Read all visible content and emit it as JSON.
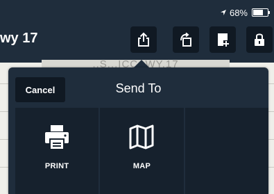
{
  "status_bar": {
    "battery": "68%",
    "battery_level": 0.68
  },
  "header": {
    "title": "wy 17"
  },
  "document": {
    "visible_text": "..S...ICC..WY.17"
  },
  "toolbar": {
    "buttons": [
      {
        "icon": "share-icon"
      },
      {
        "icon": "rotate-icon"
      },
      {
        "icon": "add-page-icon"
      },
      {
        "icon": "lock-icon"
      }
    ]
  },
  "popover": {
    "title": "Send To",
    "cancel_label": "Cancel",
    "options": [
      {
        "label": "PRINT",
        "icon": "printer-icon"
      },
      {
        "label": "MAP",
        "icon": "map-icon"
      }
    ]
  },
  "colors": {
    "bar": "#1f2d3c",
    "button": "#101923",
    "tile": "#16212d",
    "text": "#ffffff"
  }
}
